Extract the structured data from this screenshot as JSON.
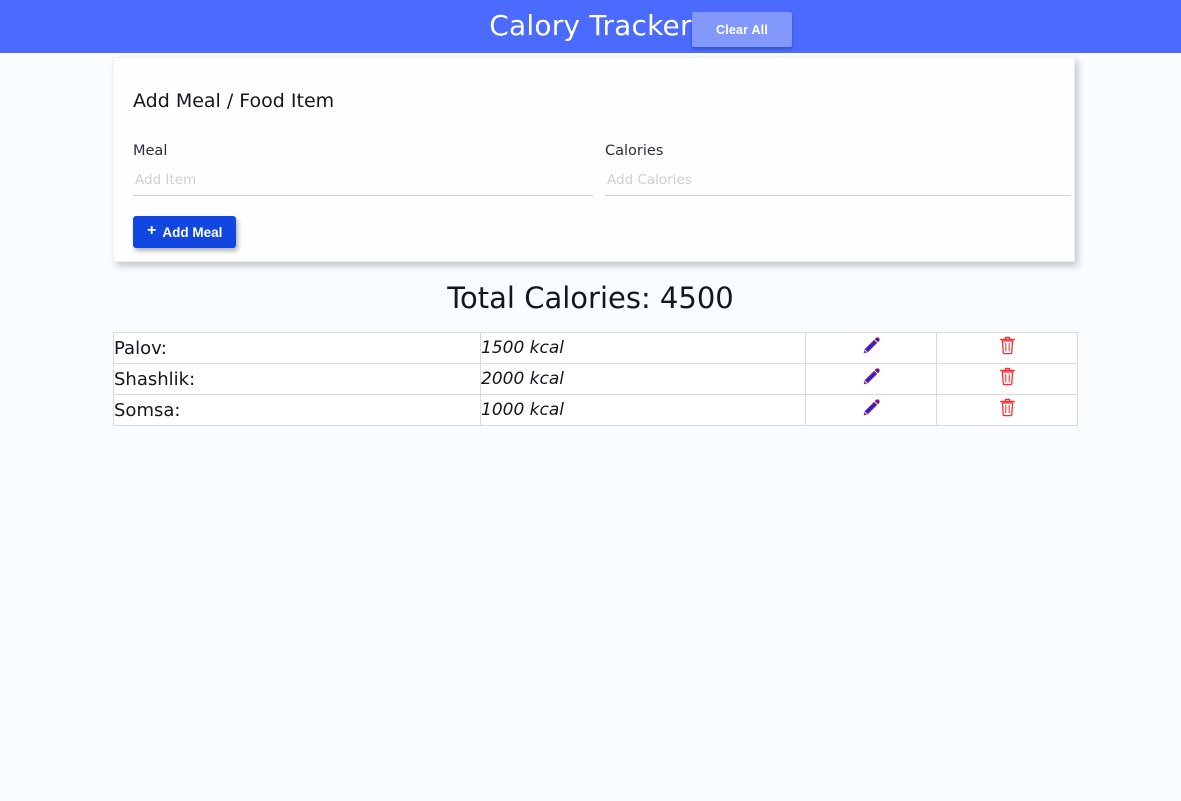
{
  "header": {
    "title": "Calory Tracker",
    "clear_all_label": "Clear All",
    "background_color": "#4a6bfd",
    "clear_all_color": "#8299fb"
  },
  "add_card": {
    "heading": "Add Meal / Food Item",
    "meal_field": {
      "label": "Meal",
      "placeholder": "Add Item",
      "value": ""
    },
    "calories_field": {
      "label": "Calories",
      "placeholder": "Add Calories",
      "value": ""
    },
    "add_button": {
      "label": "Add Meal",
      "icon": "plus-icon",
      "color": "#1246e0"
    }
  },
  "summary": {
    "total_label": "Total Calories: 4500",
    "total_value": 4500
  },
  "meal_list": {
    "rows": [
      {
        "name": "Palov:",
        "calories": "1500 kcal",
        "calories_value": 1500,
        "edit_icon": "pencil-icon",
        "delete_icon": "trash-icon"
      },
      {
        "name": "Shashlik:",
        "calories": "2000 kcal",
        "calories_value": 2000,
        "edit_icon": "pencil-icon",
        "delete_icon": "trash-icon"
      },
      {
        "name": "Somsa:",
        "calories": "1000 kcal",
        "calories_value": 1000,
        "edit_icon": "pencil-icon",
        "delete_icon": "trash-icon"
      }
    ],
    "edit_icon_color": "#2222ee",
    "delete_icon_color": "#fc2b2b"
  }
}
